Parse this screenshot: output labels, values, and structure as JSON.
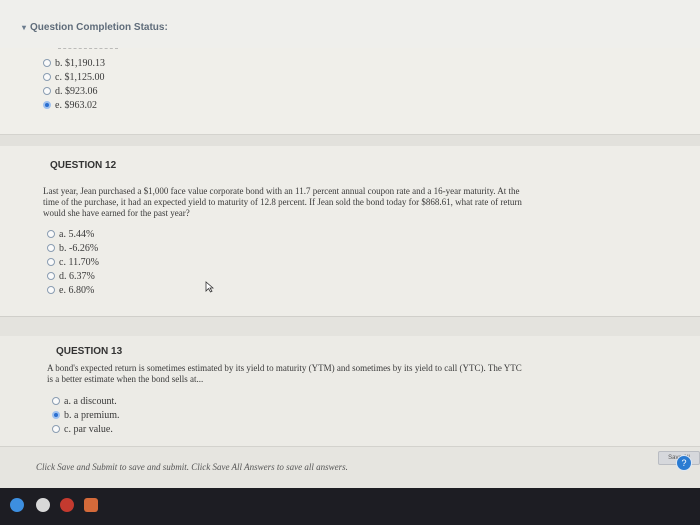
{
  "header": {
    "status_title": "Question Completion Status:"
  },
  "q11": {
    "options": [
      {
        "label": "b. $1,190.13",
        "selected": false
      },
      {
        "label": "c. $1,125.00",
        "selected": false
      },
      {
        "label": "d. $923.06",
        "selected": false
      },
      {
        "label": "e. $963.02",
        "selected": true
      }
    ]
  },
  "q12": {
    "heading": "QUESTION 12",
    "text_lines": [
      "Last year, Jean purchased a $1,000 face value corporate bond with an 11.7 percent annual coupon rate and a 16-year maturity. At the",
      "time of the purchase, it had an expected yield to maturity of 12.8 percent. If Jean sold the bond today for $868.61, what rate of return",
      "would she have earned for the past year?"
    ],
    "options": [
      {
        "label": "a. 5.44%",
        "selected": false
      },
      {
        "label": "b. -6.26%",
        "selected": false
      },
      {
        "label": "c. 11.70%",
        "selected": false
      },
      {
        "label": "d. 6.37%",
        "selected": false
      },
      {
        "label": "e. 6.80%",
        "selected": false
      }
    ]
  },
  "q13": {
    "heading": "QUESTION 13",
    "text_lines": [
      "A bond's expected return is sometimes estimated by its yield to maturity (YTM) and sometimes by its yield to call (YTC). The YTC",
      "is a better estimate when the bond sells at..."
    ],
    "options": [
      {
        "label": "a. a discount.",
        "selected": false
      },
      {
        "label": "b. a premium.",
        "selected": true
      },
      {
        "label": "c. par value.",
        "selected": false
      }
    ]
  },
  "footer": {
    "instruction": "Click Save and Submit to save and submit. Click Save All Answers to save all answers.",
    "save_all_label": "Save All"
  }
}
